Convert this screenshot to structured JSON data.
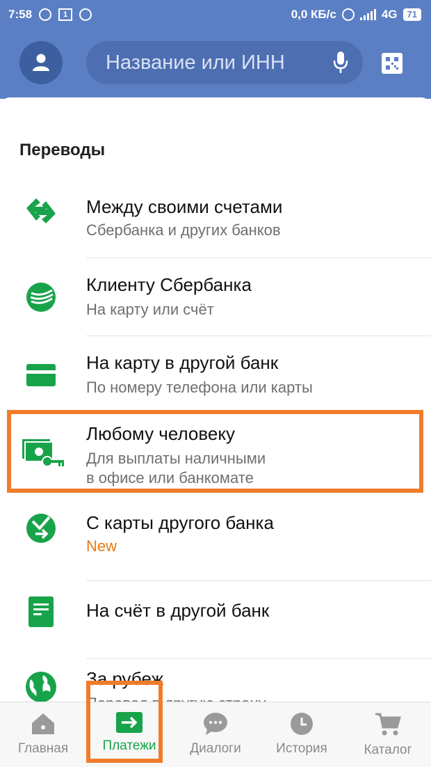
{
  "status": {
    "time": "7:58",
    "sim": "1",
    "speed": "0,0 КБ/с",
    "network": "4G",
    "battery": "71"
  },
  "search": {
    "placeholder": "Название или ИНН"
  },
  "section": {
    "title": "Переводы"
  },
  "items": [
    {
      "title": "Между своими счетами",
      "subtitle": "Сбербанка и других банков",
      "icon": "transfer-arrows-icon"
    },
    {
      "title": "Клиенту Сбербанка",
      "subtitle": "На карту или счёт",
      "icon": "sberbank-logo-icon"
    },
    {
      "title": "На карту в другой банк",
      "subtitle": "По номеру телефона или карты",
      "icon": "card-icon"
    },
    {
      "title": "Любому человеку",
      "subtitle": "Для выплаты наличными",
      "subtitle2": "в офисе или банкомате",
      "icon": "cash-key-icon"
    },
    {
      "title": "С карты другого банка",
      "badge": "New",
      "icon": "sber-incoming-icon"
    },
    {
      "title": "На счёт в другой банк",
      "icon": "document-icon"
    },
    {
      "title": "За рубеж",
      "subtitle": "Перевод в другую страну",
      "icon": "globe-icon"
    }
  ],
  "nav": [
    {
      "label": "Главная",
      "icon": "home-icon"
    },
    {
      "label": "Платежи",
      "icon": "payments-icon",
      "active": true
    },
    {
      "label": "Диалоги",
      "icon": "chat-icon"
    },
    {
      "label": "История",
      "icon": "clock-icon"
    },
    {
      "label": "Каталог",
      "icon": "cart-icon"
    }
  ],
  "colors": {
    "header": "#5b7fc4",
    "green": "#18a34a",
    "highlight": "#f07c2a",
    "new": "#e47a16"
  }
}
